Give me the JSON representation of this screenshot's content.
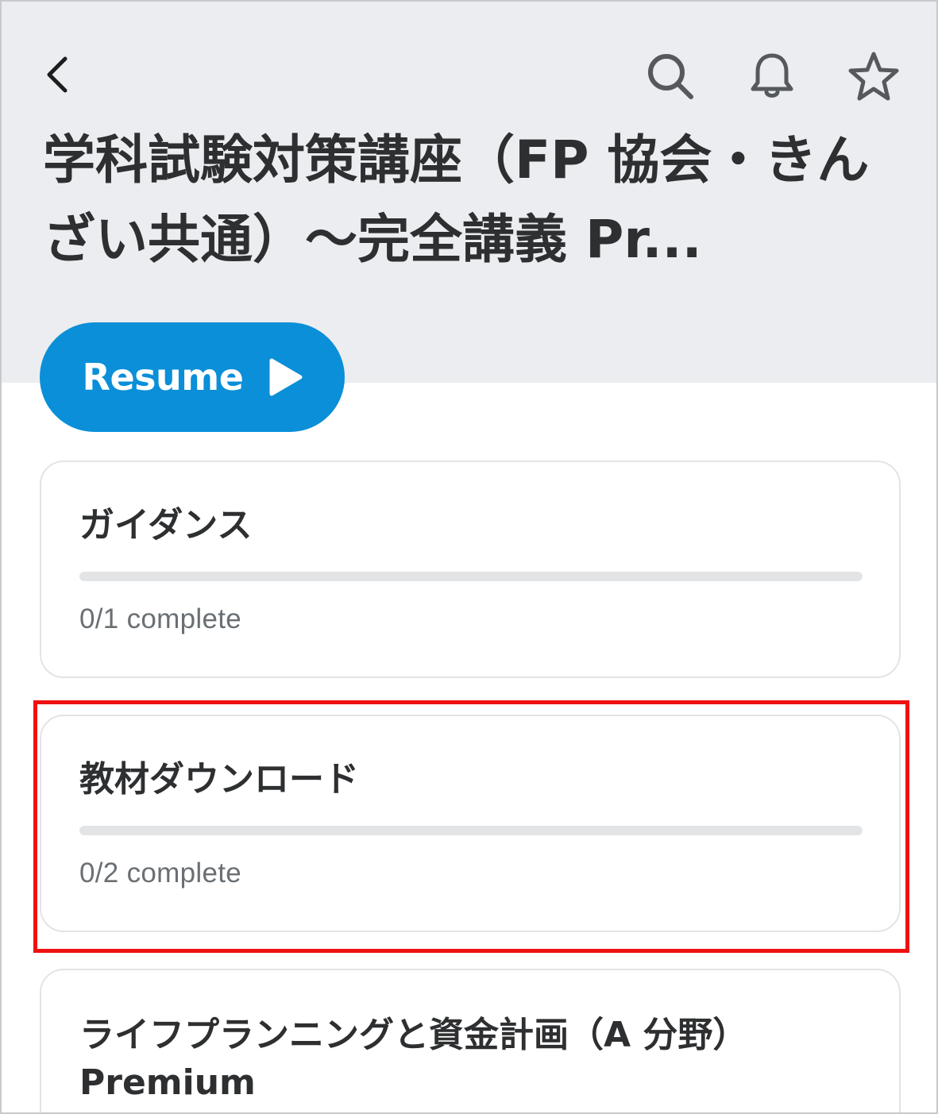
{
  "header": {
    "back_icon": "chevron-left-icon",
    "search_icon": "search-icon",
    "notification_icon": "bell-icon",
    "favorite_icon": "star-icon",
    "course_title": "学科試験対策講座（FP 協会・きんざい共通）～完全講義 Pr..."
  },
  "resume_button": {
    "label": "Resume",
    "icon": "play-icon"
  },
  "sections": [
    {
      "title": "ガイダンス",
      "progress_text": "0/1 complete",
      "completed": 0,
      "total": 1
    },
    {
      "title": "教材ダウンロード",
      "progress_text": "0/2 complete",
      "completed": 0,
      "total": 2,
      "highlighted": true
    },
    {
      "title": "ライフプランニングと資金計画（A 分野）Premium"
    }
  ],
  "colors": {
    "accent": "#0a8fd8",
    "header_background": "#ebedf0",
    "highlight": "#ee1111",
    "text_primary": "#2d2f31",
    "text_secondary": "#6a6f73",
    "track": "#e3e4e6"
  }
}
